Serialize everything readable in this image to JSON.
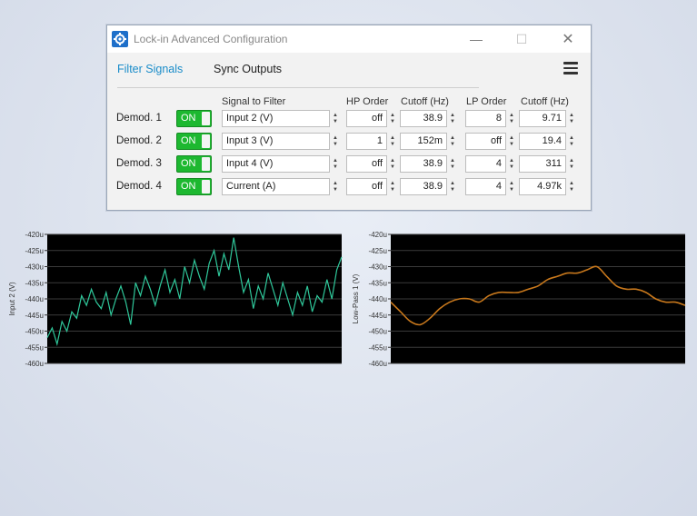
{
  "window": {
    "title": "Lock-in Advanced Configuration",
    "minimize_glyph": "—",
    "maximize_glyph": "☐",
    "close_glyph": "✕",
    "app_icon": "gear-icon",
    "accent": "#1e6fc9"
  },
  "tabs": [
    {
      "label": "Filter Signals",
      "active": true
    },
    {
      "label": "Sync Outputs",
      "active": false
    }
  ],
  "columns": {
    "signal": "Signal to Filter",
    "hp_order": "HP Order",
    "hp_cutoff": "Cutoff (Hz)",
    "lp_order": "LP Order",
    "lp_cutoff": "Cutoff (Hz)"
  },
  "rows": [
    {
      "label": "Demod. 1",
      "state": "ON",
      "signal": "Input 2 (V)",
      "hp_order": "off",
      "hp_cutoff": "38.9",
      "lp_order": "8",
      "lp_cutoff": "9.71"
    },
    {
      "label": "Demod. 2",
      "state": "ON",
      "signal": "Input 3 (V)",
      "hp_order": "1",
      "hp_cutoff": "152m",
      "lp_order": "off",
      "lp_cutoff": "19.4"
    },
    {
      "label": "Demod. 3",
      "state": "ON",
      "signal": "Input 4 (V)",
      "hp_order": "off",
      "hp_cutoff": "38.9",
      "lp_order": "4",
      "lp_cutoff": "311"
    },
    {
      "label": "Demod. 4",
      "state": "ON",
      "signal": "Current (A)",
      "hp_order": "off",
      "hp_cutoff": "38.9",
      "lp_order": "4",
      "lp_cutoff": "4.97k"
    }
  ],
  "colors": {
    "on_green": "#1db830",
    "tab_active": "#1a8cc9",
    "plot_bg": "#000000",
    "raw_line": "#2fc79a",
    "filtered_line": "#c8781c"
  },
  "chart_data": [
    {
      "type": "line",
      "ylabel": "Input 2 (V)",
      "ylim": [
        -460,
        -420
      ],
      "y_ticks": [
        "-420u",
        "-425u",
        "-430u",
        "-435u",
        "-440u",
        "-445u",
        "-450u",
        "-455u",
        "-460u"
      ],
      "grid": true,
      "series": [
        {
          "x": [
            0,
            1,
            2,
            3,
            4,
            5,
            6,
            7,
            8,
            9,
            10,
            11,
            12,
            13,
            14,
            15,
            16,
            17,
            18,
            19,
            20,
            21,
            22,
            23,
            24,
            25,
            26,
            27,
            28,
            29,
            30,
            31,
            32,
            33,
            34,
            35,
            36,
            37,
            38,
            39,
            40,
            41,
            42,
            43,
            44,
            45,
            46,
            47,
            48,
            49,
            50,
            51,
            52,
            53,
            54,
            55,
            56,
            57,
            58,
            59,
            60
          ],
          "y": [
            -452,
            -449,
            -454,
            -447,
            -450,
            -444,
            -446,
            -439,
            -442,
            -437,
            -441,
            -443,
            -438,
            -445,
            -440,
            -436,
            -441,
            -448,
            -435,
            -439,
            -433,
            -437,
            -442,
            -436,
            -431,
            -438,
            -434,
            -440,
            -430,
            -435,
            -428,
            -433,
            -437,
            -429,
            -425,
            -433,
            -426,
            -431,
            -421,
            -430,
            -438,
            -434,
            -443,
            -436,
            -440,
            -432,
            -437,
            -442,
            -435,
            -440,
            -445,
            -438,
            -442,
            -436,
            -444,
            -439,
            -441,
            -434,
            -440,
            -431,
            -427
          ]
        }
      ]
    },
    {
      "type": "line",
      "ylabel": "Low-Pass 1 (V)",
      "ylim": [
        -460,
        -420
      ],
      "y_ticks": [
        "-420u",
        "-425u",
        "-430u",
        "-435u",
        "-440u",
        "-445u",
        "-450u",
        "-455u",
        "-460u"
      ],
      "grid": true,
      "series": [
        {
          "x": [
            0,
            1,
            2,
            3,
            4,
            5,
            6,
            7,
            8,
            9,
            10,
            11,
            12,
            13,
            14,
            15,
            16,
            17,
            18,
            19,
            20,
            21,
            22,
            23,
            24,
            25,
            26,
            27,
            28,
            29,
            30
          ],
          "y": [
            -441,
            -444,
            -447,
            -448,
            -446,
            -443,
            -441,
            -440,
            -440,
            -441,
            -439,
            -438,
            -438,
            -438,
            -437,
            -436,
            -434,
            -433,
            -432,
            -432,
            -431,
            -430,
            -433,
            -436,
            -437,
            -437,
            -438,
            -440,
            -441,
            -441,
            -442
          ]
        }
      ]
    }
  ]
}
